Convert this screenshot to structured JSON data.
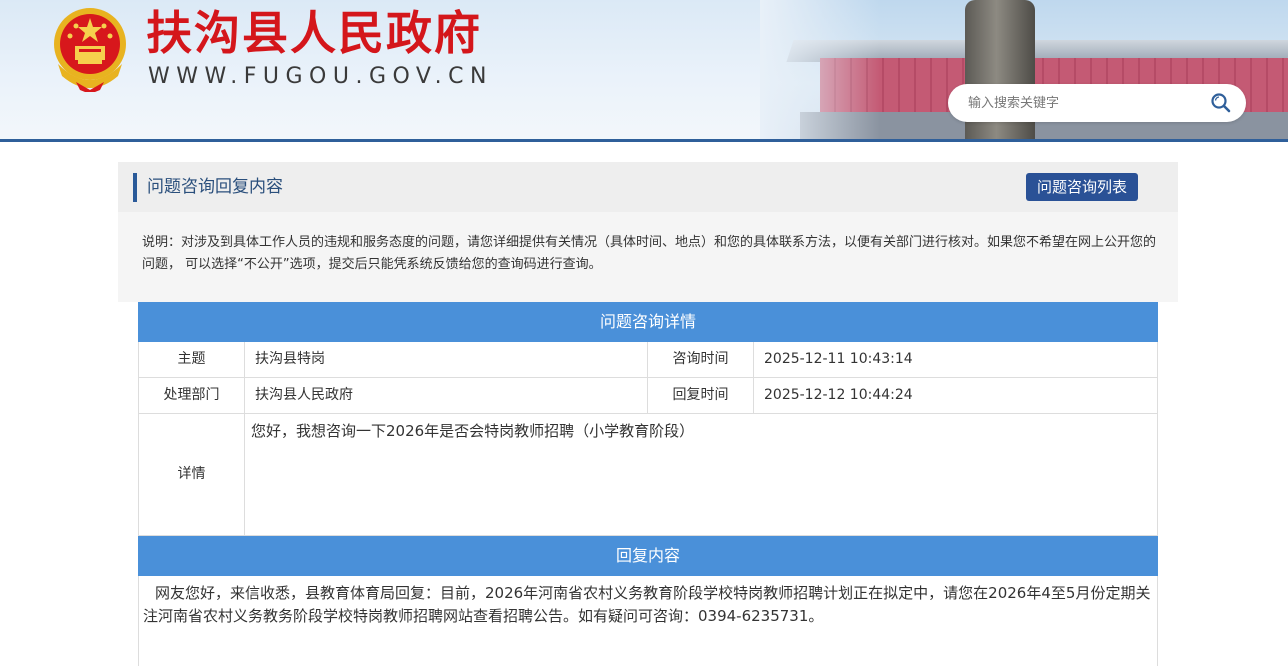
{
  "header": {
    "site_title": "扶沟县人民政府",
    "site_url": "WWW.FUGOU.GOV.CN",
    "search_placeholder": "输入搜索关键字",
    "colors": {
      "title_red": "#d4161b",
      "accent_blue": "#2f5f9a"
    }
  },
  "panel": {
    "title": "问题咨询回复内容",
    "list_button": "问题咨询列表",
    "notice": "说明：对涉及到具体工作人员的违规和服务态度的问题，请您详细提供有关情况（具体时间、地点）和您的具体联系方法，以便有关部门进行核对。如果您不希望在网上公开您的问题， 可以选择“不公开”选项，提交后只能凭系统反馈给您的查询码进行查询。"
  },
  "detail": {
    "section_title": "问题咨询详情",
    "rows": [
      {
        "label1": "主题",
        "value1": "扶沟县特岗",
        "label2": "咨询时间",
        "value2": "2025-12-11 10:43:14"
      },
      {
        "label1": "处理部门",
        "value1": "扶沟县人民政府",
        "label2": "回复时间",
        "value2": "2025-12-12 10:44:24"
      }
    ],
    "detail_label": "详情",
    "detail_text": "您好，我想咨询一下2026年是否会特岗教师招聘（小学教育阶段）"
  },
  "reply": {
    "section_title": "回复内容",
    "text": "网友您好，来信收悉，县教育体育局回复：目前，2026年河南省农村义务教育阶段学校特岗教师招聘计划正在拟定中，请您在2026年4至5月份定期关注河南省农村义务教务阶段学校特岗教师招聘网站查看招聘公告。如有疑问可咨询：0394-6235731。"
  }
}
